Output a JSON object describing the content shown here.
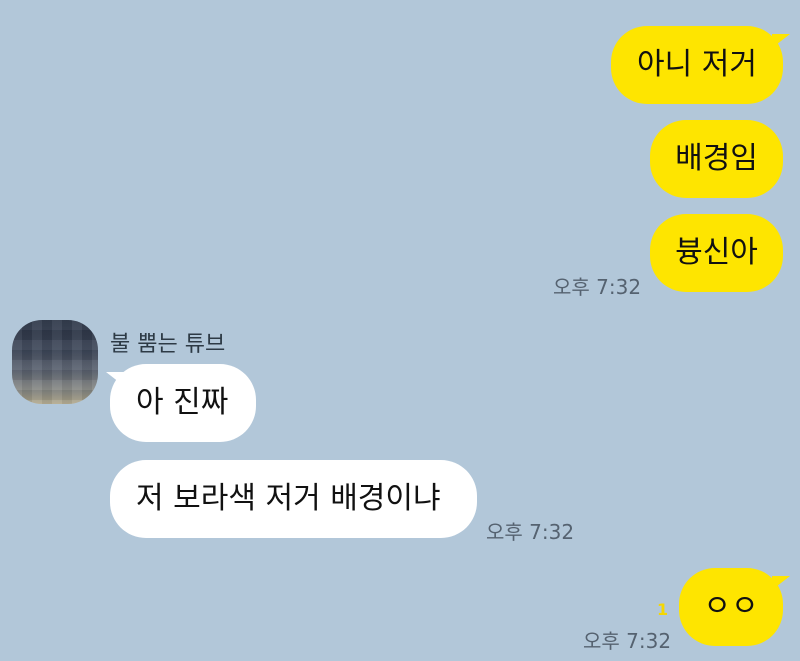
{
  "messages": {
    "m1": {
      "text": "아니 저거",
      "mine": true
    },
    "m2": {
      "text": "배경임",
      "mine": true
    },
    "m3": {
      "text": "븅신아",
      "mine": true
    },
    "t1": "오후 7:32",
    "sender": {
      "name": "불 뿜는 튜브",
      "avatar": "blurred-profile-image"
    },
    "m4": {
      "text": "아 진짜",
      "mine": false
    },
    "m5": {
      "text": "저 보라색 저거 배경이냐",
      "mine": false
    },
    "t2": "오후 7:32",
    "m6": {
      "text": "ㅇㅇ",
      "mine": true
    },
    "unread": "1",
    "t3": "오후 7:32"
  },
  "colors": {
    "background": "#b2c7d9",
    "my_bubble": "#fee500",
    "their_bubble": "#ffffff",
    "unread": "#f5d700"
  }
}
